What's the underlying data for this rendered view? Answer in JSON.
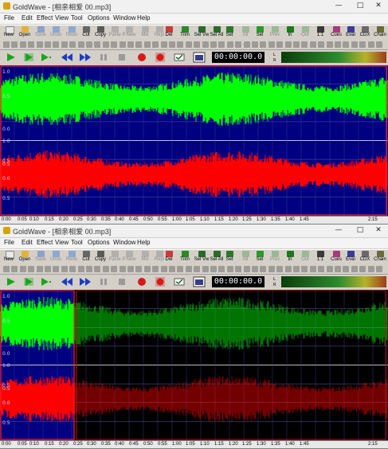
{
  "window": {
    "title": "GoldWave - [相亲相爱 00.mp3]",
    "controls": {
      "minimize": "—",
      "maximize": "□",
      "close": "✕"
    }
  },
  "menu": [
    "File",
    "Edit",
    "Effect",
    "View",
    "Tool",
    "Options",
    "Window",
    "Help"
  ],
  "toolbar": [
    {
      "label": "New",
      "icon": "new-file-icon",
      "enabled": true
    },
    {
      "label": "Open",
      "icon": "open-folder-icon",
      "enabled": true
    },
    {
      "label": "Save",
      "icon": "save-icon",
      "enabled": false
    },
    {
      "label": "Undo",
      "icon": "undo-icon",
      "enabled": false
    },
    {
      "label": "Redo",
      "icon": "redo-icon",
      "enabled": false
    },
    {
      "label": "Cut",
      "icon": "cut-icon",
      "enabled": true
    },
    {
      "label": "Copy",
      "icon": "copy-icon",
      "enabled": true
    },
    {
      "label": "Paste",
      "icon": "paste-icon",
      "enabled": false
    },
    {
      "label": "P.New",
      "icon": "paste-new-icon",
      "enabled": false
    },
    {
      "label": "Mix",
      "icon": "mix-icon",
      "enabled": false
    },
    {
      "label": "Repl",
      "icon": "replace-icon",
      "enabled": false
    },
    {
      "label": "Del",
      "icon": "delete-icon",
      "enabled": true
    },
    {
      "label": "Trim",
      "icon": "trim-icon",
      "enabled": true
    },
    {
      "label": "Sel Vw",
      "icon": "select-view-icon",
      "enabled": true
    },
    {
      "label": "Sel All",
      "icon": "select-all-icon",
      "enabled": true
    },
    {
      "label": "Set",
      "icon": "set-marker-icon",
      "enabled": true
    },
    {
      "label": "All",
      "icon": "zoom-all-icon",
      "enabled": false
    },
    {
      "label": "Sel",
      "icon": "zoom-selection-icon",
      "enabled": true
    },
    {
      "label": "Prev",
      "icon": "zoom-previous-icon",
      "enabled": false
    },
    {
      "label": "In",
      "icon": "zoom-in-icon",
      "enabled": true
    },
    {
      "label": "Out",
      "icon": "zoom-out-icon",
      "enabled": false
    },
    {
      "label": "1:1",
      "icon": "zoom-1-1-icon",
      "enabled": true
    },
    {
      "label": "Cues",
      "icon": "cues-icon",
      "enabled": true
    },
    {
      "label": "Eval",
      "icon": "eval-icon",
      "enabled": true
    },
    {
      "label": "CDX",
      "icon": "cd-extract-icon",
      "enabled": true
    },
    {
      "label": "Chain",
      "icon": "chain-icon",
      "enabled": true
    },
    {
      "label": "Help",
      "icon": "help-icon",
      "enabled": true
    }
  ],
  "transport": {
    "buttons": [
      {
        "name": "play-button",
        "icon": "play-icon"
      },
      {
        "name": "play-selection-button",
        "icon": "play-selection-icon"
      },
      {
        "name": "play-from-button",
        "icon": "play-from-icon"
      },
      {
        "name": "rewind-button",
        "icon": "rewind-icon"
      },
      {
        "name": "fast-forward-button",
        "icon": "fast-forward-icon"
      },
      {
        "name": "pause-button",
        "icon": "pause-icon"
      },
      {
        "name": "stop-button",
        "icon": "stop-icon"
      },
      {
        "name": "record-button",
        "icon": "record-icon"
      },
      {
        "name": "record-selection-button",
        "icon": "record-selection-icon"
      }
    ],
    "time": "00:00:00.0",
    "channels": [
      "L",
      "R"
    ]
  },
  "waveform": {
    "left_channel_color": "#00ff00",
    "right_channel_color": "#ff0000",
    "background_color": "#000080",
    "unselected_background_color": "#000000",
    "scale_labels": [
      "1.0",
      "0.5",
      "0.0",
      "0.5",
      "1.0",
      "0.5",
      "0.0",
      "0.5"
    ]
  },
  "timeline": {
    "labels": [
      "0:00",
      "0:05",
      "0:10",
      "0:15",
      "0:20",
      "0:25",
      "0:30",
      "0:35",
      "0:40",
      "0:45",
      "0:50",
      "0:55",
      "1:00",
      "1:05",
      "1:10",
      "1:15",
      "1:20",
      "1:25",
      "1:30",
      "1:35",
      "1:40",
      "1:45",
      "2:15"
    ]
  },
  "views": [
    {
      "selection": "full"
    },
    {
      "selection": "start",
      "selection_end_fraction": 0.19
    }
  ]
}
